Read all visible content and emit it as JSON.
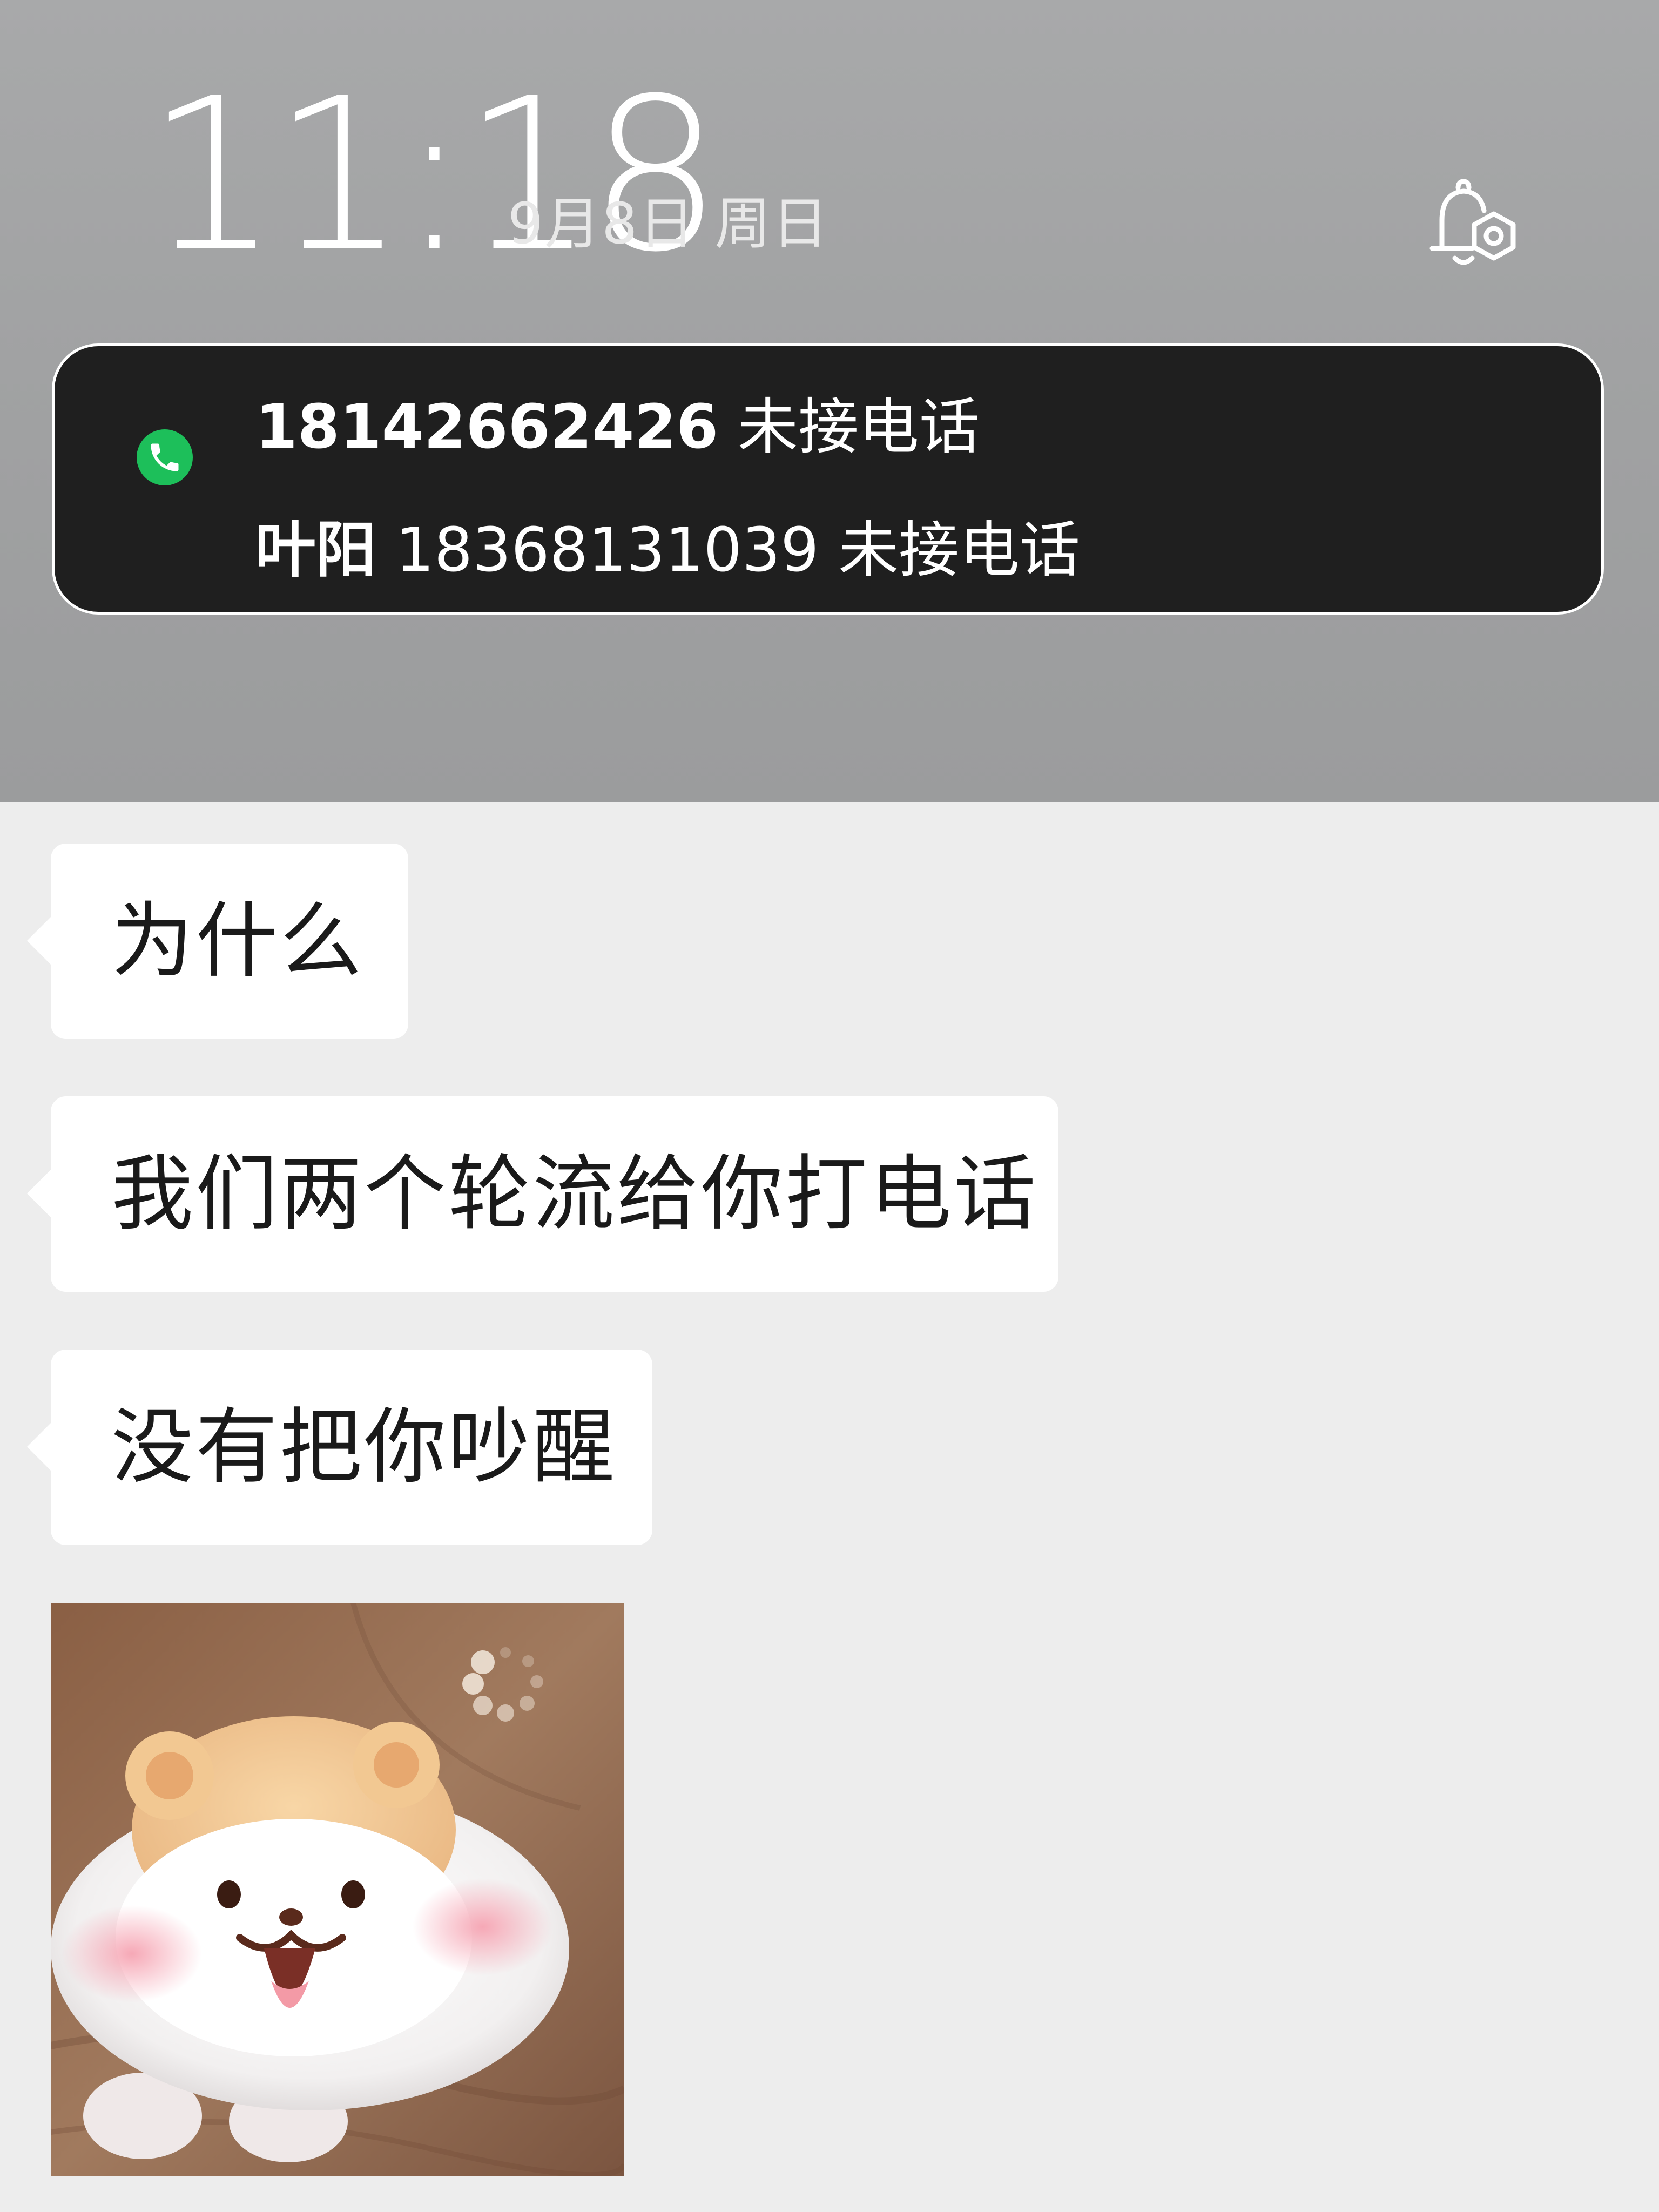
{
  "lock_screen": {
    "time": "11:18",
    "date": "9月8日 周日",
    "status_icon": "bell-settings-icon"
  },
  "notification": {
    "app_icon": "phone-icon",
    "lines": [
      {
        "name": "",
        "number": "18142662426",
        "status": "未接电话"
      },
      {
        "name": "叶阳",
        "number": "18368131039",
        "status": "未接电话"
      }
    ]
  },
  "chat": {
    "messages": [
      {
        "text": "为什么"
      },
      {
        "text": "我们两个轮流给你打电话"
      },
      {
        "text": "没有把你吵醒"
      }
    ],
    "sticker": {
      "icon": "hamster-sticker"
    }
  },
  "colors": {
    "chat_background": "#ededed",
    "bubble_background": "#ffffff",
    "notification_background": "#1f1f1f",
    "call_icon_green": "#1dbf5a"
  }
}
